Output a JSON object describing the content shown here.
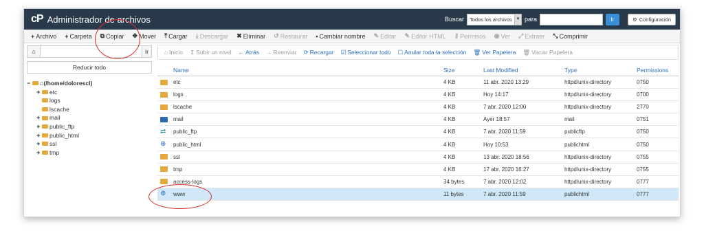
{
  "header": {
    "logo": "cP",
    "title": "Administrador de archivos",
    "search_label": "Buscar",
    "search_scope": "Todos los archivos",
    "for_label": "para",
    "go_label": "Ir",
    "settings_label": "Configuración"
  },
  "toolbar": [
    {
      "icon": "+",
      "label": "Archivo",
      "enabled": true
    },
    {
      "icon": "+",
      "label": "Carpeta",
      "enabled": true
    },
    {
      "icon": "⧉",
      "label": "Copiar",
      "enabled": true
    },
    {
      "icon": "✥",
      "label": "Mover",
      "enabled": true
    },
    {
      "icon": "⤒",
      "label": "Cargar",
      "enabled": true
    },
    {
      "icon": "⤓",
      "label": "Descargar",
      "enabled": false
    },
    {
      "icon": "✖",
      "label": "Eliminar",
      "enabled": true
    },
    {
      "icon": "↺",
      "label": "Restaurar",
      "enabled": false
    },
    {
      "icon": "▪",
      "label": "Cambiar nombre",
      "enabled": true
    },
    {
      "icon": "✎",
      "label": "Editar",
      "enabled": false
    },
    {
      "icon": "✎",
      "label": "Editor HTML",
      "enabled": false
    },
    {
      "icon": "⚷",
      "label": "Permisos",
      "enabled": false
    },
    {
      "icon": "◉",
      "label": "Ver",
      "enabled": false
    },
    {
      "icon": "⤢",
      "label": "Extraer",
      "enabled": false
    },
    {
      "icon": "⤡",
      "label": "Comprimir",
      "enabled": true
    }
  ],
  "sidebar": {
    "go_label": "Ir",
    "collapse_label": "Reducir todo",
    "tree": [
      {
        "prefix": "−",
        "label": "(/home/dolorescl)",
        "level": 0,
        "root": true
      },
      {
        "prefix": "+",
        "label": "etc",
        "level": 1
      },
      {
        "prefix": "",
        "label": "logs",
        "level": 2
      },
      {
        "prefix": "",
        "label": "lscache",
        "level": 2
      },
      {
        "prefix": "+",
        "label": "mail",
        "level": 1
      },
      {
        "prefix": "+",
        "label": "public_ftp",
        "level": 1
      },
      {
        "prefix": "+",
        "label": "public_html",
        "level": 1
      },
      {
        "prefix": "+",
        "label": "ssl",
        "level": 1
      },
      {
        "prefix": "+",
        "label": "tmp",
        "level": 1
      }
    ]
  },
  "navbar": [
    {
      "icon": "⌂",
      "label": "Inicio",
      "style": "dis"
    },
    {
      "icon": "↥",
      "label": "Subir un nivel",
      "style": "dis"
    },
    {
      "icon": "←",
      "label": "Atrás",
      "style": "blue"
    },
    {
      "icon": "→",
      "label": "Reenviar",
      "style": "dis"
    },
    {
      "icon": "⟳",
      "label": "Recargar",
      "style": "blue"
    },
    {
      "icon": "☑",
      "label": "Seleccionar todo",
      "style": "blue"
    },
    {
      "icon": "☐",
      "label": "Anular toda la selección",
      "style": "blue"
    },
    {
      "icon": "🗑",
      "label": "Ver Papelera",
      "style": "blue"
    },
    {
      "icon": "🗑",
      "label": "Vaciar Papelera",
      "style": "dis"
    }
  ],
  "table": {
    "headers": {
      "name": "Name",
      "size": "Size",
      "modified": "Last Modified",
      "type": "Type",
      "perms": "Permissions"
    },
    "rows": [
      {
        "icon": "folder",
        "name": "etc",
        "size": "4 KB",
        "modified": "11 abr. 2020 13:29",
        "type": "httpd/unix-directory",
        "perms": "0750"
      },
      {
        "icon": "folder",
        "name": "logs",
        "size": "4 KB",
        "modified": "Hoy 14:17",
        "type": "httpd/unix-directory",
        "perms": "0700"
      },
      {
        "icon": "folder",
        "name": "lscache",
        "size": "4 KB",
        "modified": "7 abr. 2020 12:00",
        "type": "httpd/unix-directory",
        "perms": "2770"
      },
      {
        "icon": "mail",
        "name": "mail",
        "size": "4 KB",
        "modified": "Ayer 18:57",
        "type": "mail",
        "perms": "0751"
      },
      {
        "icon": "ftp",
        "name": "public_ftp",
        "size": "4 KB",
        "modified": "7 abr. 2020 11:59",
        "type": "publicftp",
        "perms": "0750"
      },
      {
        "icon": "globe",
        "name": "public_html",
        "size": "4 KB",
        "modified": "Hoy 10:53",
        "type": "publichtml",
        "perms": "0750"
      },
      {
        "icon": "folder",
        "name": "ssl",
        "size": "4 KB",
        "modified": "13 abr. 2020 18:56",
        "type": "httpd/unix-directory",
        "perms": "0755"
      },
      {
        "icon": "folder",
        "name": "tmp",
        "size": "4 KB",
        "modified": "17 abr. 2020 16:27",
        "type": "httpd/unix-directory",
        "perms": "0755"
      },
      {
        "icon": "folder-link",
        "name": "access-logs",
        "size": "34 bytes",
        "modified": "7 abr. 2020 12:02",
        "type": "httpd/unix-directory",
        "perms": "0777"
      },
      {
        "icon": "globe-link",
        "name": "www",
        "size": "11 bytes",
        "modified": "7 abr. 2020 11:59",
        "type": "publichtml",
        "perms": "0777",
        "selected": true
      }
    ]
  }
}
